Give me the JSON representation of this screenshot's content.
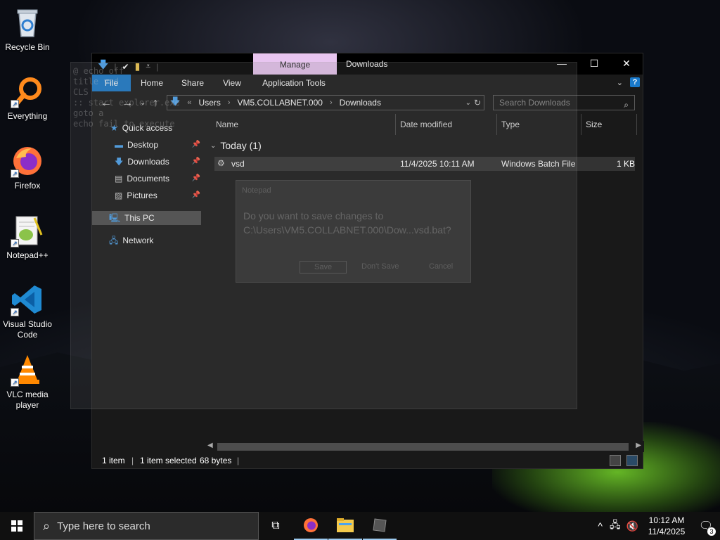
{
  "desktop": {
    "icons": [
      {
        "label": "Recycle Bin",
        "icon": "recycle-bin-icon"
      },
      {
        "label": "Everything",
        "icon": "everything-search-icon"
      },
      {
        "label": "Firefox",
        "icon": "firefox-icon"
      },
      {
        "label": "Notepad++",
        "icon": "notepad-plus-plus-icon"
      },
      {
        "label": "Visual Studio Code",
        "icon": "vscode-icon"
      },
      {
        "label": "VLC media player",
        "icon": "vlc-icon"
      }
    ]
  },
  "window": {
    "title": "Downloads",
    "contextual_tab": "Manage",
    "ribbon_tabs": {
      "file": "File",
      "home": "Home",
      "share": "Share",
      "view": "View",
      "app_tools": "Application Tools"
    },
    "help": "?",
    "address": {
      "overflow": "«",
      "crumbs": [
        "Users",
        "VM5.COLLABNET.000",
        "Downloads"
      ]
    },
    "search_placeholder": "Search Downloads",
    "nav": {
      "quick_access": "Quick access",
      "desktop": "Desktop",
      "downloads": "Downloads",
      "documents": "Documents",
      "pictures": "Pictures",
      "this_pc": "This PC",
      "network": "Network"
    },
    "columns": {
      "name": "Name",
      "date": "Date modified",
      "type": "Type",
      "size": "Size"
    },
    "group": {
      "label": "Today (1)"
    },
    "files": [
      {
        "name": "vsd",
        "date": "11/4/2025 10:11 AM",
        "type": "Windows Batch File",
        "size": "1 KB"
      }
    ],
    "status": {
      "count": "1 item",
      "selection": "1 item selected",
      "size": "68 bytes"
    }
  },
  "ghost": {
    "lines": [
      "@ echo off",
      "title vsd",
      "CLS",
      ":: start explorer.exe",
      "goto a",
      "echo fail to execute"
    ],
    "dialog": {
      "title": "Notepad",
      "message_line1": "Do you want to save changes to",
      "message_line2": "C:\\Users\\VM5.COLLABNET.000\\Dow...vsd.bat?",
      "save": "Save",
      "dont_save": "Don't Save",
      "cancel": "Cancel"
    }
  },
  "taskbar": {
    "search_placeholder": "Type here to search",
    "time": "10:12 AM",
    "date": "11/4/2025",
    "notification_count": "3"
  },
  "colors": {
    "accent": "#1979ca",
    "manage_tab": "#e8c5f0",
    "selected_row": "#333333"
  }
}
